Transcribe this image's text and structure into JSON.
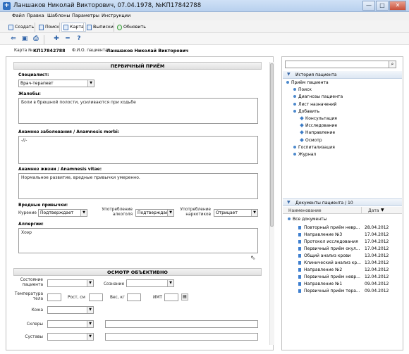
{
  "window": {
    "title": "Ланшаков Николай Викторович, 07.04.1978, №КП17842788",
    "buttons": [
      "—",
      "□",
      "✕"
    ]
  },
  "menubar": [
    "Файл",
    "Правка",
    "Шаблоны",
    "Параметры",
    "Инструкции"
  ],
  "toolbar1": {
    "items": [
      {
        "label": "Создать",
        "icon": "new-doc-icon"
      },
      {
        "label": "Поиск",
        "icon": "search-doc-icon"
      },
      {
        "label": "Карта",
        "icon": "card-icon"
      },
      {
        "label": "Выписки",
        "icon": "extract-icon"
      },
      {
        "label": "Обновить",
        "icon": "refresh-icon"
      }
    ]
  },
  "toolbar2": {
    "icons": [
      "back-arrow-icon",
      "save-icon",
      "print-icon",
      "add-icon",
      "remove-icon",
      "help-icon"
    ],
    "glyphs": [
      "⇐",
      "▣",
      "⎙",
      "✚",
      "━",
      "?"
    ]
  },
  "patient": {
    "card_label": "Карта №",
    "card_number": "КП17842788",
    "fio_label": "Ф.И.О. пациента",
    "fio": "Ланшаков Николай Викторович"
  },
  "primary": {
    "header": "ПЕРВИЧНЫЙ ПРИЁМ",
    "specialist_label": "Специалист:",
    "specialist_value": "Врач-терапевт",
    "complaints_label": "Жалобы:",
    "complaints_text": "Боли в брюшной полости, усиливаются при ходьбе",
    "anamnesis_morbi_label": "Анамнез заболевания / Anamnesis morbi:",
    "anamnesis_morbi_text": "-//-",
    "anamnesis_vitae_label": "Анамнез жизни / Anamnesis vitae:",
    "anamnesis_vitae_text": "Нормальное развитие, вредные привычки умеренно.",
    "habits_label": "Вредные привычки:",
    "smoking_label": "Курение",
    "smoking_value": "Подтверждает",
    "alcohol_label": "Употребление алкоголя",
    "alcohol_value": "Подтверждает",
    "drugs_label": "Употребление наркотиков",
    "drugs_value": "Отрицает",
    "allergies_label": "Аллергии:",
    "allergies_text": "Хоэр"
  },
  "objective": {
    "header": "ОСМОТР ОБЪЕКТИВНО",
    "state_label": "Состояние пациента",
    "consciousness_label": "Сознание",
    "temperature_label": "Температура тела",
    "height_label": "Рост, см",
    "weight_label": "Вес, кг",
    "bmi_label": "ИМТ",
    "skin_label": "Кожа",
    "sclera_label": "Склеры",
    "joints_label": "Суставы"
  },
  "history_panel": {
    "search_placeholder": "",
    "header": "История пациента",
    "items": [
      {
        "label": "Приём пациента",
        "level": 0
      },
      {
        "label": "Поиск",
        "level": 1
      },
      {
        "label": "Диагнозы пациента",
        "level": 1
      },
      {
        "label": "Лист назначений",
        "level": 1
      },
      {
        "label": "Добавить",
        "level": 1
      },
      {
        "label": "Консультация",
        "level": 2
      },
      {
        "label": "Исследование",
        "level": 2
      },
      {
        "label": "Направление",
        "level": 2
      },
      {
        "label": "Осмотр",
        "level": 2
      },
      {
        "label": "Госпитализация",
        "level": 1
      },
      {
        "label": "Журнал",
        "level": 1
      }
    ]
  },
  "documents_panel": {
    "header": "Документы пациента / 10",
    "col_name": "Наименование",
    "col_date": "Дата",
    "root": "Все документы",
    "docs": [
      {
        "name": "Повторный приём невр...",
        "date": "28.04.2012"
      },
      {
        "name": "Направление №3",
        "date": "17.04.2012"
      },
      {
        "name": "Протокол исследования",
        "date": "17.04.2012"
      },
      {
        "name": "Первичный приём окул...",
        "date": "17.04.2012"
      },
      {
        "name": "Общий анализ крови",
        "date": "13.04.2012"
      },
      {
        "name": "Клинический анализ кр...",
        "date": "13.04.2012"
      },
      {
        "name": "Направление №2",
        "date": "12.04.2012"
      },
      {
        "name": "Первичный приём невр...",
        "date": "12.04.2012"
      },
      {
        "name": "Направление №1",
        "date": "09.04.2012"
      },
      {
        "name": "Первичный приём тера...",
        "date": "09.04.2012"
      }
    ]
  },
  "colors": {
    "titlebar": "#c4d8f1",
    "accent": "#3f7fcf"
  }
}
